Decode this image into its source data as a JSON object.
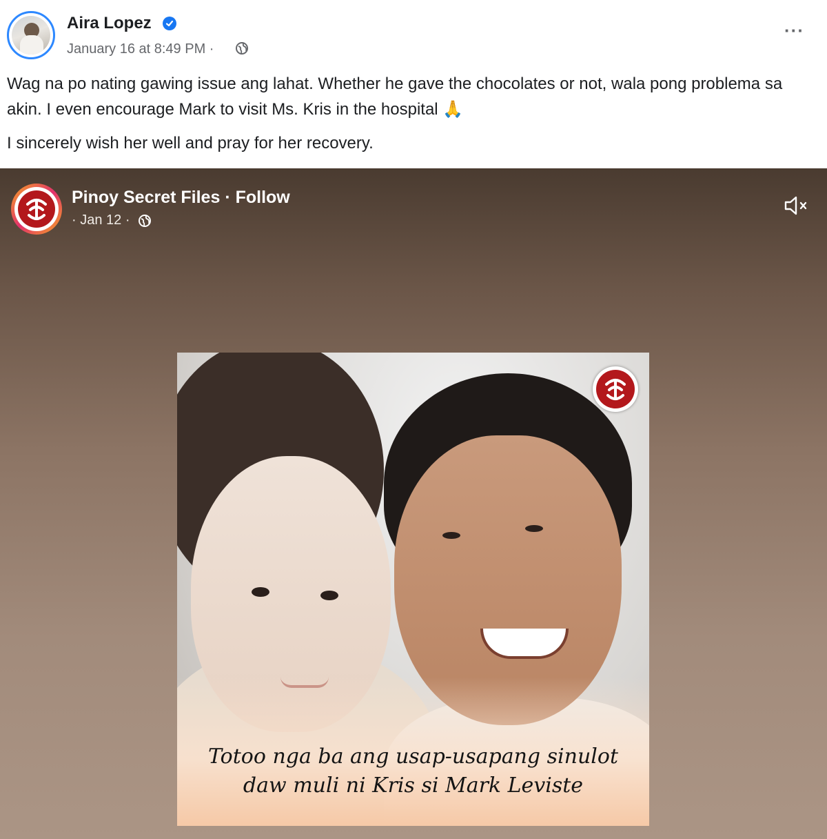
{
  "post": {
    "author": "Aira Lopez",
    "timestamp": "January 16 at 8:49 PM ·",
    "paragraph1": "Wag na po nating gawing issue ang lahat. Whether he gave the chocolates or not, wala pong problema sa akin. I even encourage Mark to visit Ms. Kris in the hospital",
    "pray_emoji": "🙏",
    "paragraph2": "I sincerely wish her well and pray for her recovery.",
    "more_label": "···",
    "icons": {
      "verified": "verified-badge-icon",
      "audience": "globe-icon",
      "more": "more-options-icon"
    }
  },
  "shared": {
    "page_name": "Pinoy Secret Files · Follow",
    "date": "· Jan 12 ·",
    "icons": {
      "audience": "globe-icon",
      "sound": "muted-speaker-icon"
    },
    "caption_line1": "Totoo nga ba ang usap-usapang sinulot",
    "caption_line2": "daw muli ni Kris si Mark Leviste"
  },
  "colors": {
    "accent": "#1877f2",
    "logo_red": "#b3181c",
    "meta_gray": "#65676b"
  }
}
